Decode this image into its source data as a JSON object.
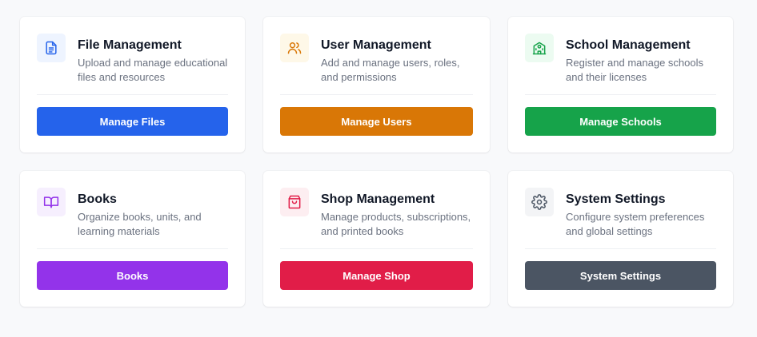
{
  "cards": [
    {
      "title": "File Management",
      "description": "Upload and manage educational files and resources",
      "button_label": "Manage Files",
      "icon": "file-icon",
      "accent": "#2563eb",
      "icon_bg": "#eef4ff"
    },
    {
      "title": "User Management",
      "description": "Add and manage users, roles, and permissions",
      "button_label": "Manage Users",
      "icon": "users-icon",
      "accent": "#d97706",
      "icon_bg": "#fef8e8"
    },
    {
      "title": "School Management",
      "description": "Register and manage schools and their licenses",
      "button_label": "Manage Schools",
      "icon": "school-icon",
      "accent": "#16a34a",
      "icon_bg": "#ecfbf1"
    },
    {
      "title": "Books",
      "description": "Organize books, units, and learning materials",
      "button_label": "Books",
      "icon": "book-icon",
      "accent": "#9333ea",
      "icon_bg": "#f6effe"
    },
    {
      "title": "Shop Management",
      "description": "Manage products, subscriptions, and printed books",
      "button_label": "Manage Shop",
      "icon": "shopping-bag-icon",
      "accent": "#e11d48",
      "icon_bg": "#fdeef1"
    },
    {
      "title": "System Settings",
      "description": "Configure system preferences and global settings",
      "button_label": "System Settings",
      "icon": "gear-icon",
      "accent": "#4b5563",
      "icon_bg": "#f3f4f6"
    }
  ]
}
